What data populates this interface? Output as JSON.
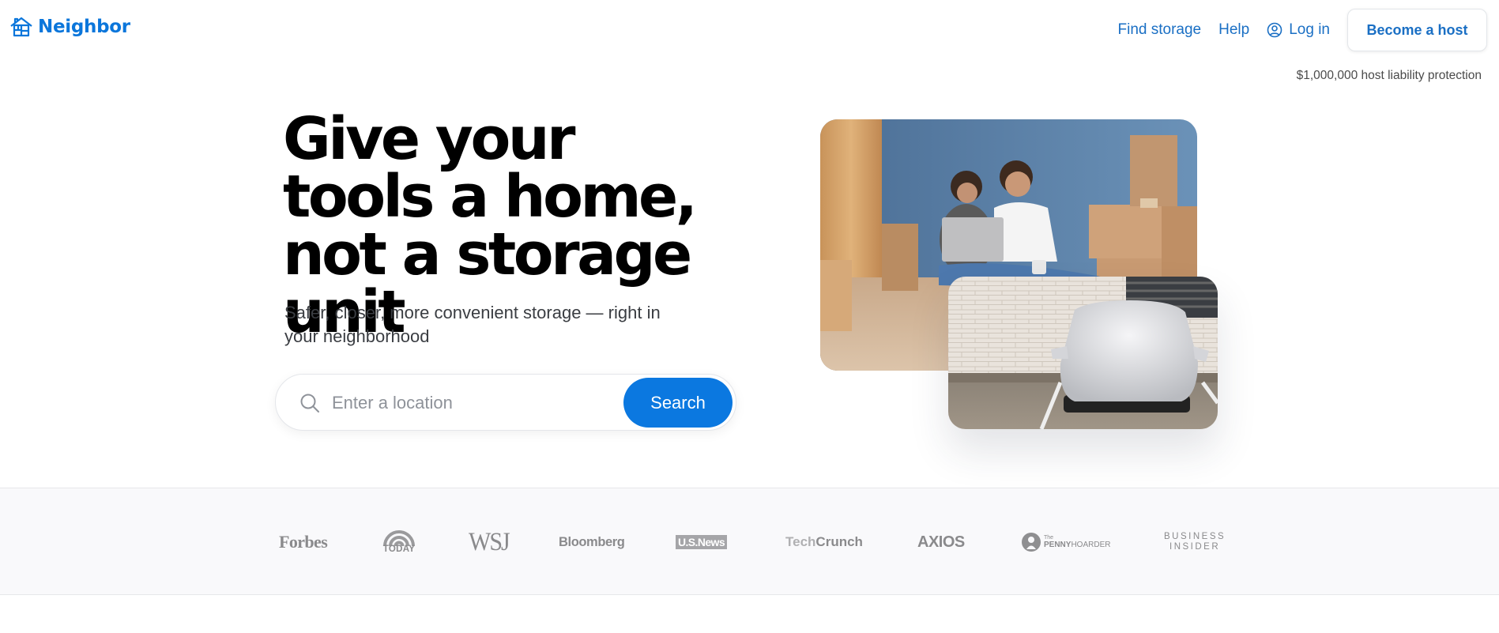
{
  "header": {
    "brand": "Neighbor",
    "brand_color": "#0b76db",
    "nav": {
      "find_storage": "Find storage",
      "help": "Help",
      "login": "Log in",
      "become_host": "Become a host"
    },
    "liability_note": "$1,000,000 host liability protection"
  },
  "hero": {
    "title": "Give your tools a home, not a storage unit",
    "subtitle": "Safer, closer, more convenient storage — right in your neighborhood",
    "search": {
      "placeholder": "Enter a location",
      "value": "",
      "button_label": "Search",
      "button_color": "#0b78e0"
    },
    "images": [
      {
        "alt": "Couple sitting on floor with laptop among moving boxes"
      },
      {
        "alt": "Car under a silver cover parked against a brick wall"
      }
    ]
  },
  "press": {
    "logos": [
      {
        "name": "Forbes",
        "text": "Forbes"
      },
      {
        "name": "TODAY",
        "text": "TODAY"
      },
      {
        "name": "WSJ",
        "text": "WSJ"
      },
      {
        "name": "Bloomberg",
        "text": "Bloomberg"
      },
      {
        "name": "U.S. News",
        "text": "U.S.News"
      },
      {
        "name": "TechCrunch",
        "text_light": "Tech",
        "text_bold": "Crunch"
      },
      {
        "name": "Axios",
        "text": "AXIOS"
      },
      {
        "name": "The Penny Hoarder",
        "text_the": "The",
        "text_penny": "PENNY",
        "text_hoarder": "HOARDER"
      },
      {
        "name": "Business Insider",
        "line1": "BUSINESS",
        "line2": "INSIDER"
      }
    ]
  }
}
